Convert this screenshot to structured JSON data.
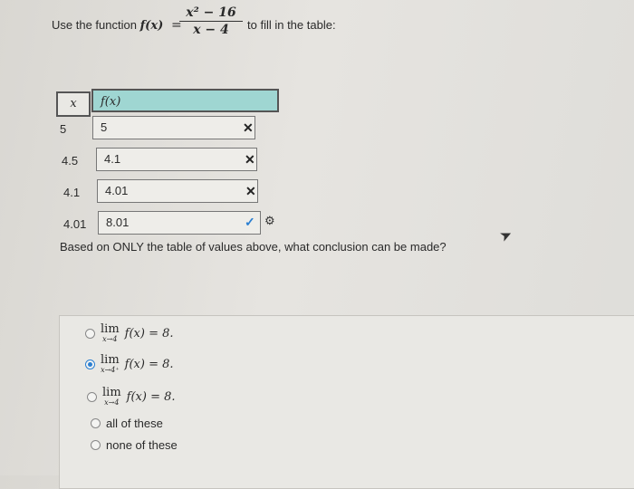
{
  "prompt": {
    "prefix": "Use the function",
    "func": "f(x)",
    "equals": "=",
    "numerator": "x² − 16",
    "denominator": "x − 4",
    "suffix": "to fill in the table:"
  },
  "table": {
    "header_x": "x",
    "header_fx": "f(x)",
    "rows": [
      {
        "x": "5",
        "value": "5",
        "status": "wrong"
      },
      {
        "x": "4.5",
        "value": "4.1",
        "status": "wrong"
      },
      {
        "x": "4.1",
        "value": "4.01",
        "status": "wrong"
      },
      {
        "x": "4.01",
        "value": "8.01",
        "status": "right"
      }
    ],
    "wrong_mark": "✕",
    "right_mark": "✓",
    "gear_glyph": "⚙"
  },
  "question": "Based on ONLY the table of values above, what conclusion can be made?",
  "options": [
    {
      "lim": "lim",
      "sub": "x→4",
      "expr": "f(x) = 8.",
      "selected": false
    },
    {
      "lim": "lim",
      "sub": "x→4⁺",
      "expr": "f(x) = 8.",
      "selected": true
    },
    {
      "lim": "lim",
      "sub": "x→4",
      "expr": "f(x) = 8.",
      "selected": false
    },
    {
      "text": "all of these",
      "selected": false
    },
    {
      "text": "none of these",
      "selected": false
    }
  ],
  "colors": {
    "accent": "#2b7fd1",
    "header_fill": "#9fd6d2"
  },
  "icons": [
    "close-icon",
    "check-icon",
    "gear-icon",
    "mouse-cursor-icon"
  ]
}
